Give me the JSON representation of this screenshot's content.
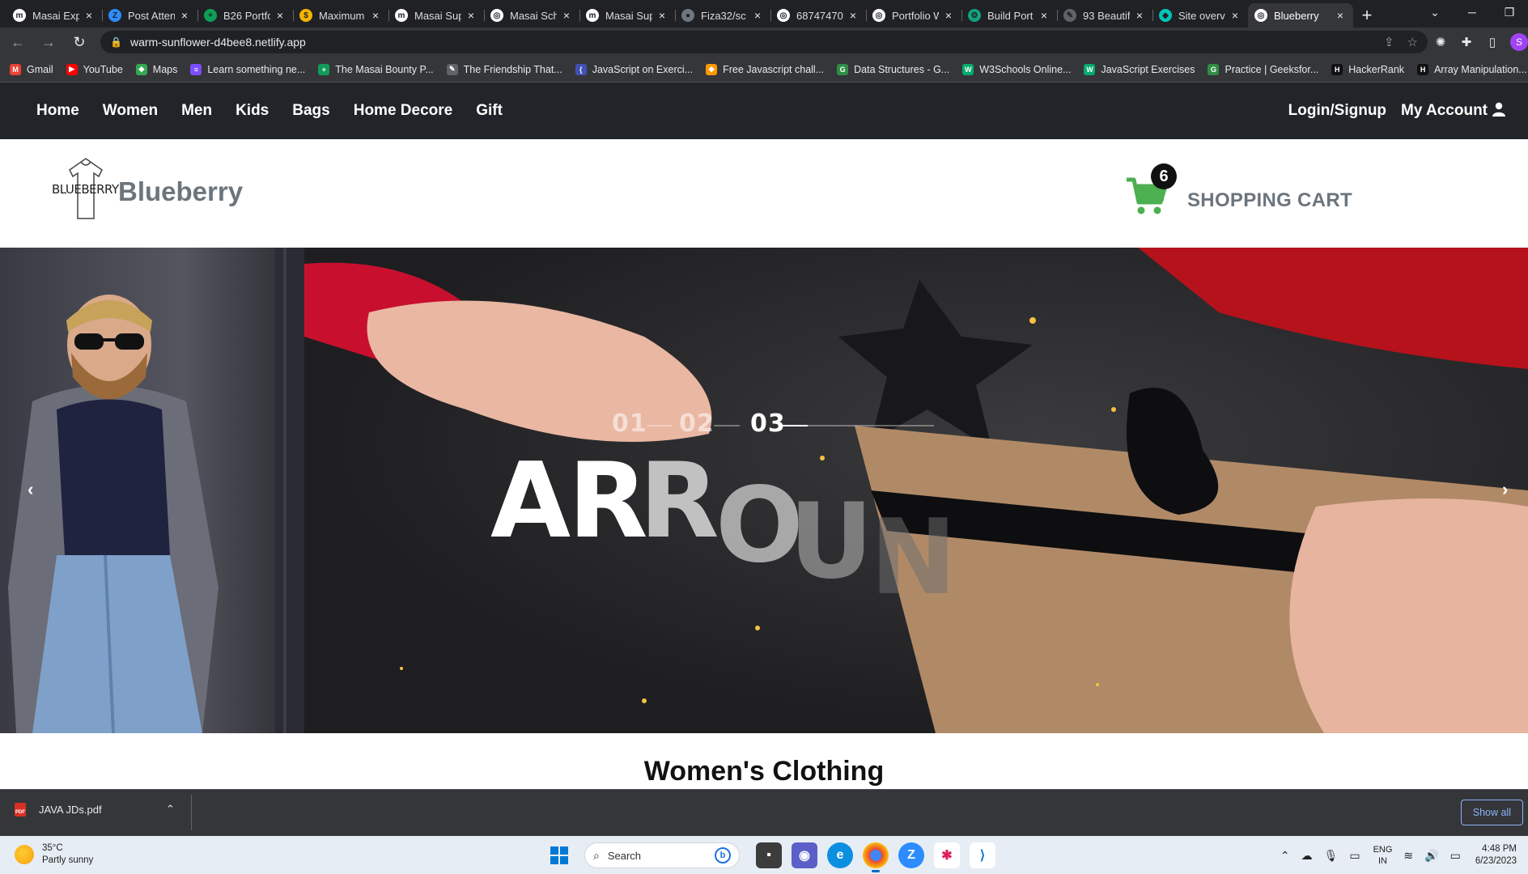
{
  "browser": {
    "tabs": [
      {
        "title": "Masai Exp",
        "fav_color": "#ffffff",
        "fav_char": "m"
      },
      {
        "title": "Post Atten",
        "fav_color": "#2d8cff",
        "fav_char": "Z"
      },
      {
        "title": "B26 Portfo",
        "fav_color": "#0f9d58",
        "fav_char": "+"
      },
      {
        "title": "Maximum",
        "fav_color": "#f4b400",
        "fav_char": "$"
      },
      {
        "title": "Masai Sup",
        "fav_color": "#ffffff",
        "fav_char": "m"
      },
      {
        "title": "Masai Sch",
        "fav_color": "#ffffff",
        "fav_char": "◎"
      },
      {
        "title": "Masai Sup",
        "fav_color": "#ffffff",
        "fav_char": "m"
      },
      {
        "title": "Fiza32/sc",
        "fav_color": "#6e7681",
        "fav_char": "●"
      },
      {
        "title": "68747470",
        "fav_color": "#ffffff",
        "fav_char": "◎"
      },
      {
        "title": "Portfolio W",
        "fav_color": "#ffffff",
        "fav_char": "◎"
      },
      {
        "title": "Build Port",
        "fav_color": "#10a37f",
        "fav_char": "⚙"
      },
      {
        "title": "93 Beautif",
        "fav_color": "#5f6368",
        "fav_char": "✎"
      },
      {
        "title": "Site overv",
        "fav_color": "#00c7b7",
        "fav_char": "◆"
      },
      {
        "title": "Blueberry",
        "fav_color": "#ffffff",
        "fav_char": "◎",
        "active": true
      }
    ],
    "new_tab": "+",
    "close_glyph": "×",
    "url": "warm-sunflower-d4bee8.netlify.app",
    "profile_initial": "S",
    "bookmarks": [
      {
        "label": "Gmail",
        "color": "#ea4335",
        "char": "M"
      },
      {
        "label": "YouTube",
        "color": "#ff0000",
        "char": "▶"
      },
      {
        "label": "Maps",
        "color": "#34a853",
        "char": "◆"
      },
      {
        "label": "Learn something ne...",
        "color": "#7c4dff",
        "char": "≡"
      },
      {
        "label": "The Masai Bounty P...",
        "color": "#0f9d58",
        "char": "+"
      },
      {
        "label": "The Friendship That...",
        "color": "#5f6368",
        "char": "✎"
      },
      {
        "label": "JavaScript on Exerci...",
        "color": "#3f51b5",
        "char": "{"
      },
      {
        "label": "Free Javascript chall...",
        "color": "#ff9800",
        "char": "◆"
      },
      {
        "label": "Data Structures - G...",
        "color": "#2f8d46",
        "char": "G"
      },
      {
        "label": "W3Schools Online...",
        "color": "#04aa6d",
        "char": "W"
      },
      {
        "label": "JavaScript Exercises",
        "color": "#04aa6d",
        "char": "W"
      },
      {
        "label": "Practice | Geeksfor...",
        "color": "#2f8d46",
        "char": "G"
      },
      {
        "label": "HackerRank",
        "color": "#111111",
        "char": "H"
      },
      {
        "label": "Array Manipulation...",
        "color": "#111111",
        "char": "H"
      }
    ]
  },
  "site": {
    "nav_left": [
      "Home",
      "Women",
      "Men",
      "Kids",
      "Bags",
      "Home Decore",
      "Gift"
    ],
    "nav_login": "Login/Signup",
    "nav_account": "My Account",
    "logo_text": "BLUEBERRY",
    "brand": "Blueberry",
    "cart_count": "6",
    "cart_label": "SHOPPING CART",
    "slider": {
      "indices": [
        "01",
        "02",
        "03"
      ],
      "active_index": 2,
      "prev_glyph": "‹",
      "next_glyph": "›",
      "headline_letters": [
        "A",
        "R",
        "R",
        "O",
        "U",
        "N"
      ]
    },
    "section_title": "Women's Clothing"
  },
  "downloads": {
    "file": "JAVA JDs.pdf",
    "show_all": "Show all"
  },
  "taskbar": {
    "temp": "35°C",
    "weather": "Partly sunny",
    "search_placeholder": "Search",
    "lang_top": "ENG",
    "lang_bottom": "IN",
    "time": "4:48 PM",
    "date": "6/23/2023"
  },
  "colors": {
    "nav_bg": "#212529",
    "brand_grey": "#6c757d",
    "cart_green": "#4caf50"
  }
}
